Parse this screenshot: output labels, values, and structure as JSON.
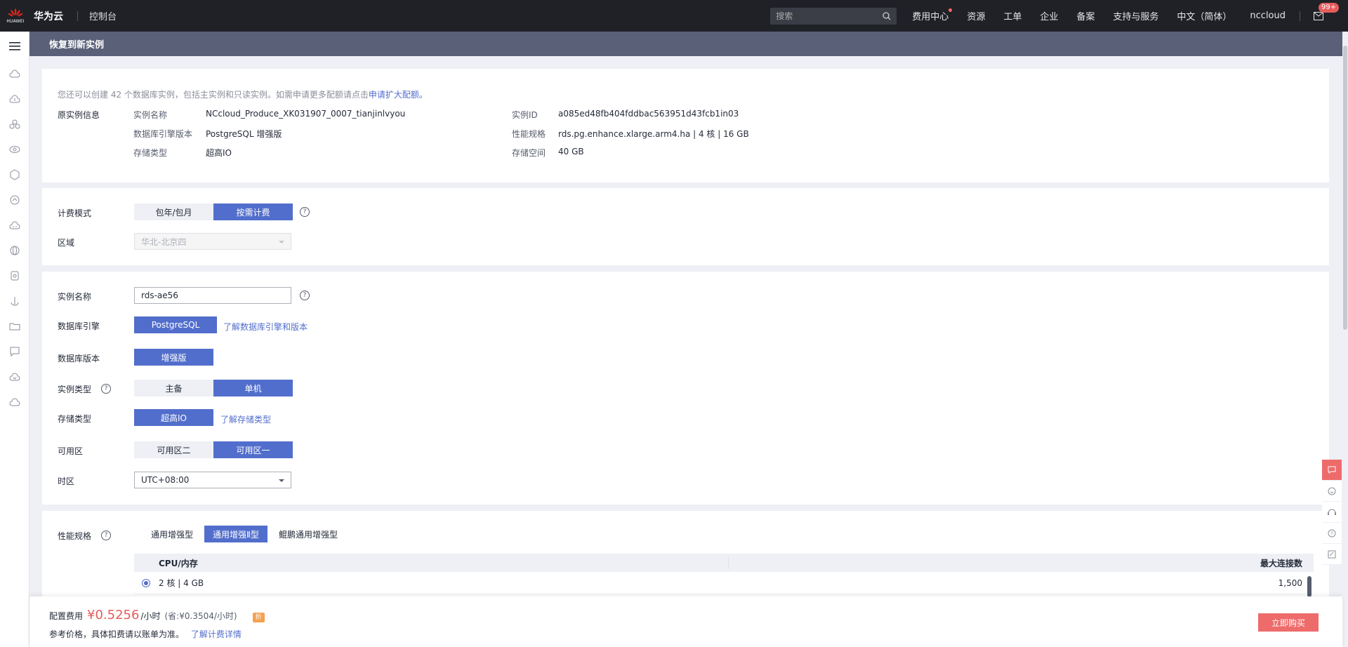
{
  "topbar": {
    "brand": "华为云",
    "logo_text": "HUAWEI",
    "console": "控制台",
    "search_placeholder": "搜索",
    "nav": [
      "费用中心",
      "资源",
      "工单",
      "企业",
      "备案",
      "支持与服务",
      "中文（简体）"
    ],
    "user": "nccloud",
    "mail_badge": "99+"
  },
  "page": {
    "title": "恢复到新实例"
  },
  "quota_notice": {
    "text": "您还可以创建 42 个数据库实例，包括主实例和只读实例。如需申请更多配额请点击",
    "link": "申请扩大配额。"
  },
  "source_instance": {
    "section_label": "原实例信息",
    "left": [
      {
        "label": "实例名称",
        "value": "NCcloud_Produce_XK031907_0007_tianjinlvyou"
      },
      {
        "label": "数据库引擎版本",
        "value": "PostgreSQL 增强版"
      },
      {
        "label": "存储类型",
        "value": "超高IO"
      }
    ],
    "right": [
      {
        "label": "实例ID",
        "value": "a085ed48fb404fddbac563951d43fcb1in03"
      },
      {
        "label": "性能规格",
        "value": "rds.pg.enhance.xlarge.arm4.ha | 4 核 | 16 GB"
      },
      {
        "label": "存储空间",
        "value": "40 GB"
      }
    ]
  },
  "billing": {
    "label": "计费模式",
    "options": [
      "包年/包月",
      "按需计费"
    ],
    "selected": 1,
    "region_label": "区域",
    "region_value": "华北-北京四"
  },
  "config": {
    "name_label": "实例名称",
    "name_value": "rds-ae56",
    "engine_label": "数据库引擎",
    "engine_value": "PostgreSQL",
    "engine_link": "了解数据库引擎和版本",
    "version_label": "数据库版本",
    "version_value": "增强版",
    "type_label": "实例类型",
    "type_options": [
      "主备",
      "单机"
    ],
    "storage_label": "存储类型",
    "storage_value": "超高IO",
    "storage_link": "了解存储类型",
    "az_label": "可用区",
    "az_options": [
      "可用区二",
      "可用区一"
    ],
    "tz_label": "时区",
    "tz_value": "UTC+08:00"
  },
  "performance": {
    "label": "性能规格",
    "tabs": [
      "通用增强型",
      "通用增强Ⅱ型",
      "鲲鹏通用增强型"
    ],
    "selected_tab": 1,
    "columns": [
      "CPU/内存",
      "最大连接数"
    ],
    "rows": [
      {
        "spec": "2 核 | 4 GB",
        "conn": "1,500"
      }
    ]
  },
  "footer": {
    "price_label": "配置费用",
    "price": "¥0.5256",
    "unit": "/小时",
    "saved": "(省:¥0.3504/小时)",
    "discount": "折",
    "ref_text": "参考价格，具体扣费请以账单为准。",
    "ref_link": "了解计费详情",
    "buy": "立即购买"
  }
}
